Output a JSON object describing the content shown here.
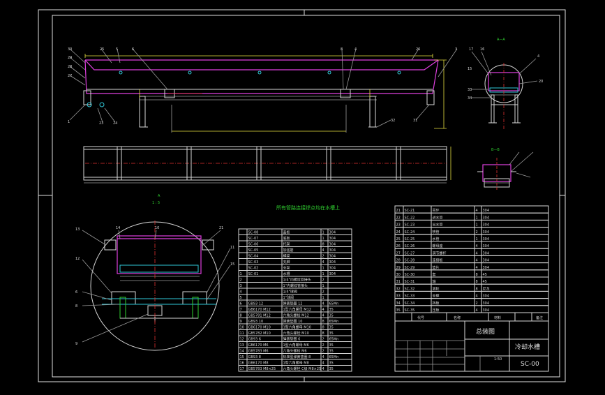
{
  "title_block": {
    "assembly_label": "总装图",
    "product_name": "冷却水槽",
    "drawing_number": "SC-00",
    "scale": "1:50",
    "header_code": "代号",
    "header_name": "名称",
    "header_material": "材料",
    "header_remark": "备注"
  },
  "note": "所有管路连接焊点均在水槽上",
  "views": {
    "section_a_label": "A—A",
    "section_b_label": "B—B",
    "detail_label": "A",
    "detail_scale": "1 : 5"
  },
  "callouts": {
    "front_left": [
      "30",
      "29",
      "28",
      "27",
      "1"
    ],
    "front_top": [
      "25",
      "5",
      "6",
      "8",
      "4",
      "26",
      "3"
    ],
    "front_bottom": [
      "23",
      "24",
      "32",
      "31"
    ],
    "detail_left": [
      "13",
      "12",
      "6",
      "8",
      "9"
    ],
    "detail_top": [
      "14",
      "10",
      "21"
    ],
    "detail_right": [
      "11",
      "15"
    ],
    "side": [
      "17",
      "16",
      "15",
      "33",
      "34",
      "35",
      "12",
      "14",
      "19",
      "4",
      "20",
      "21",
      "22"
    ]
  },
  "parts_left": [
    {
      "no": "17",
      "code": "GB5783 M8×25",
      "name": "六角头螺栓 C级 M8×25",
      "qty": "4",
      "mat": "35"
    },
    {
      "no": "16",
      "code": "GB6170 M8",
      "name": "1型六角螺母 M8",
      "qty": "4",
      "mat": "35"
    },
    {
      "no": "15",
      "code": "GB93 8",
      "name": "标准型弹簧垫圈 8",
      "qty": "4",
      "mat": "65Mn"
    },
    {
      "no": "14",
      "code": "GB5783 M6",
      "name": "六角头螺栓 M6",
      "qty": "2",
      "mat": "35"
    },
    {
      "no": "13",
      "code": "GB6170 M6",
      "name": "1型六角螺母 M6",
      "qty": "2",
      "mat": "35"
    },
    {
      "no": "12",
      "code": "GB93 6",
      "name": "弹簧垫圈 6",
      "qty": "2",
      "mat": "65Mn"
    },
    {
      "no": "11",
      "code": "GB5782 M10",
      "name": "六角头螺栓 M10",
      "qty": "8",
      "mat": "35"
    },
    {
      "no": "10",
      "code": "GB6170 M10",
      "name": "1型六角螺母 M10",
      "qty": "8",
      "mat": "35"
    },
    {
      "no": "9",
      "code": "GB93 10",
      "name": "弹簧垫圈 10",
      "qty": "8",
      "mat": "65Mn"
    },
    {
      "no": "8",
      "code": "GB5781 M12",
      "name": "六角头螺栓 M12",
      "qty": "4",
      "mat": "35"
    },
    {
      "no": "7",
      "code": "GB6170 M12",
      "name": "1型六角螺母 M12",
      "qty": "4",
      "mat": "35"
    },
    {
      "no": "6",
      "code": "GB93 12",
      "name": "弹簧垫圈 12",
      "qty": "4",
      "mat": "65Mn"
    },
    {
      "no": "5",
      "code": "",
      "name": "1\"球阀",
      "qty": "1",
      "mat": ""
    },
    {
      "no": "4",
      "code": "",
      "name": "1/4\"球阀",
      "qty": "2",
      "mat": ""
    },
    {
      "no": "3",
      "code": "",
      "name": "1\"内螺纹管接头",
      "qty": "1",
      "mat": ""
    },
    {
      "no": "2",
      "code": "",
      "name": "1/4\"内螺纹管接头",
      "qty": "2",
      "mat": ""
    },
    {
      "no": "1",
      "code": "SC-01",
      "name": "水槽",
      "qty": "1",
      "mat": "304"
    },
    {
      "no": "",
      "code": "SC-02",
      "name": "支架",
      "qty": "1",
      "mat": "304"
    },
    {
      "no": "",
      "code": "SC-03",
      "name": "支脚",
      "qty": "4",
      "mat": "304"
    },
    {
      "no": "",
      "code": "SC-04",
      "name": "横梁",
      "qty": "2",
      "mat": "304"
    },
    {
      "no": "",
      "code": "SC-05",
      "name": "加强筋",
      "qty": "4",
      "mat": "304"
    },
    {
      "no": "",
      "code": "SC-06",
      "name": "托架",
      "qty": "8",
      "mat": "304"
    },
    {
      "no": "",
      "code": "SC-07",
      "name": "底板",
      "qty": "1",
      "mat": "304"
    },
    {
      "no": "",
      "code": "SC-08",
      "name": "盖板",
      "qty": "1",
      "mat": "304"
    }
  ],
  "parts_right": [
    {
      "no": "35",
      "code": "SC-35",
      "name": "压板",
      "qty": "4",
      "mat": "304"
    },
    {
      "no": "34",
      "code": "SC-34",
      "name": "挡板",
      "qty": "2",
      "mat": "304"
    },
    {
      "no": "33",
      "code": "SC-33",
      "name": "支撑",
      "qty": "4",
      "mat": "304"
    },
    {
      "no": "32",
      "code": "SC-32",
      "name": "滚轮",
      "qty": "8",
      "mat": "尼龙"
    },
    {
      "no": "31",
      "code": "SC-31",
      "name": "轴",
      "qty": "8",
      "mat": "45"
    },
    {
      "no": "30",
      "code": "SC-30",
      "name": "套",
      "qty": "8",
      "mat": "45"
    },
    {
      "no": "29",
      "code": "SC-29",
      "name": "垫片",
      "qty": "4",
      "mat": "304"
    },
    {
      "no": "28",
      "code": "SC-28",
      "name": "连接板",
      "qty": "4",
      "mat": "304"
    },
    {
      "no": "27",
      "code": "SC-27",
      "name": "调节螺杆",
      "qty": "4",
      "mat": "304"
    },
    {
      "no": "26",
      "code": "SC-26",
      "name": "螺母座",
      "qty": "4",
      "mat": "304"
    },
    {
      "no": "25",
      "code": "SC-25",
      "name": "水管",
      "qty": "1",
      "mat": "304"
    },
    {
      "no": "24",
      "code": "SC-24",
      "name": "喷管",
      "qty": "2",
      "mat": "304"
    },
    {
      "no": "23",
      "code": "SC-23",
      "name": "出水管",
      "qty": "1",
      "mat": "304"
    },
    {
      "no": "22",
      "code": "SC-22",
      "name": "进水管",
      "qty": "1",
      "mat": "304"
    },
    {
      "no": "21",
      "code": "SC-21",
      "name": "吊环",
      "qty": "4",
      "mat": "304"
    }
  ],
  "colors": {
    "frame": "#e0e0e0",
    "magenta": "#e040e0",
    "green": "#30d030",
    "yellow": "#e8e040",
    "cyan": "#30c8d8",
    "red": "#e03030"
  }
}
